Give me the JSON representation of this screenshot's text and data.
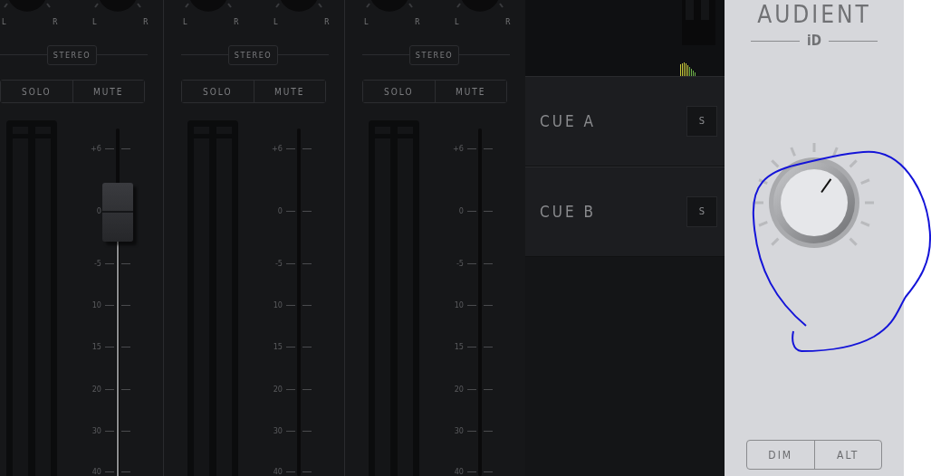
{
  "channels": [
    {
      "pan_labels": [
        "L",
        "R",
        "L",
        "R"
      ],
      "mode": "STEREO",
      "solo": {
        "label": "SOLO",
        "on": false
      },
      "mute": {
        "label": "MUTE",
        "on": false
      },
      "scale": [
        "+6",
        "0",
        "-5",
        "10",
        "15",
        "20",
        "30",
        "40"
      ],
      "level": 0.76
    },
    {
      "pan_labels": [
        "L",
        "R",
        "L",
        "R"
      ],
      "mode": "STEREO",
      "solo": {
        "label": "SOLO",
        "on": false
      },
      "mute": {
        "label": "MUTE",
        "on": false
      },
      "scale": [
        "+6",
        "0",
        "-5",
        "10",
        "15",
        "20",
        "30",
        "40"
      ],
      "fader_track": true
    },
    {
      "pan_labels": [
        "L",
        "R",
        "L",
        "R"
      ],
      "mode": "STEREO",
      "solo": {
        "label": "SOLO",
        "on": false
      },
      "mute": {
        "label": "MUTE",
        "on": false
      },
      "scale": [
        "+6",
        "0",
        "-5",
        "10",
        "15",
        "20",
        "30",
        "40"
      ],
      "fader_track": true
    }
  ],
  "cues": [
    {
      "label": "CUE A",
      "solo_label": "S",
      "solo_on": false
    },
    {
      "label": "CUE B",
      "solo_label": "S",
      "solo_on": false
    }
  ],
  "monitor": {
    "brand": "AUDIENT",
    "model": "iD",
    "level": 0.63,
    "buttons": [
      {
        "label": "DIM",
        "on": false
      },
      {
        "label": "ALT",
        "on": false
      }
    ]
  }
}
